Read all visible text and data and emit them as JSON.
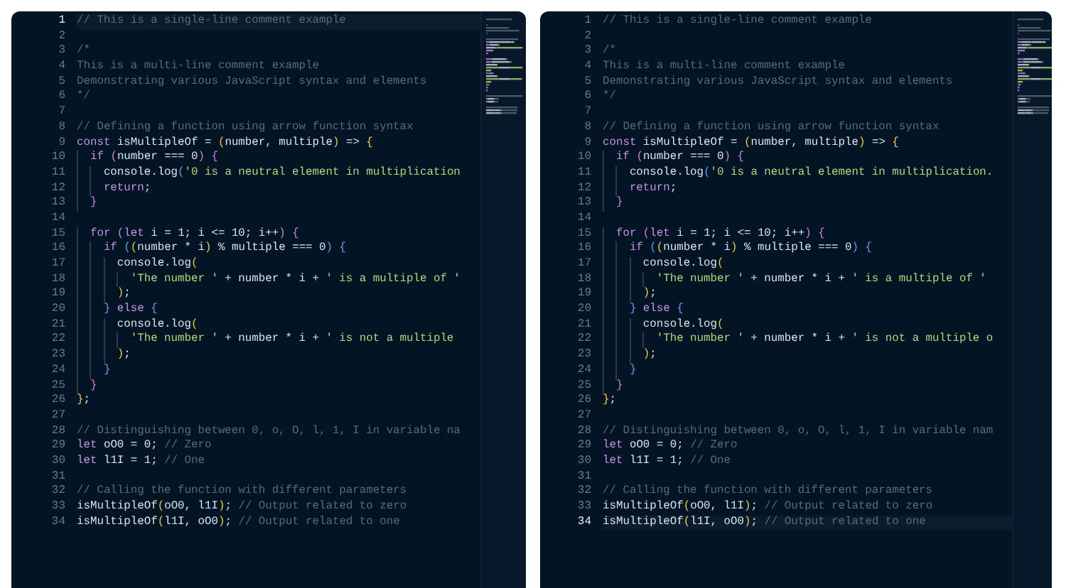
{
  "editors": [
    {
      "lines": [
        {
          "number": "1",
          "selected": true,
          "tokens": [
            {
              "kind": "comment",
              "text": "// This is a single-line comment example"
            }
          ]
        },
        {
          "number": "2",
          "selected": false
        },
        {
          "number": "3",
          "selected": false,
          "tokens": [
            {
              "kind": "comment",
              "text": "/*"
            }
          ]
        },
        {
          "number": "4",
          "selected": false,
          "tokens": [
            {
              "kind": "comment",
              "text": "This is a multi-line comment example"
            }
          ]
        },
        {
          "number": "5",
          "selected": false,
          "tokens": [
            {
              "kind": "comment",
              "text": "Demonstrating various JavaScript syntax and elements"
            }
          ]
        },
        {
          "number": "6",
          "selected": false,
          "tokens": [
            {
              "kind": "comment",
              "text": "*/"
            }
          ]
        },
        {
          "number": "7",
          "selected": false
        },
        {
          "number": "8",
          "selected": false,
          "tokens": [
            {
              "kind": "comment",
              "text": "// Defining a function using arrow function syntax"
            }
          ]
        },
        {
          "number": "9",
          "selected": false,
          "tokens": [
            {
              "kind": "keyword",
              "text": "const"
            },
            {
              "kind": "plain",
              "text": " isMultipleOf = "
            },
            {
              "kind": "bracket1",
              "text": "("
            },
            {
              "kind": "plain",
              "text": "number, multiple"
            },
            {
              "kind": "bracket1",
              "text": ")"
            },
            {
              "kind": "plain",
              "text": " => "
            },
            {
              "kind": "bracket1",
              "text": "{"
            }
          ]
        },
        {
          "number": "10",
          "selected": false,
          "tokens": [
            {
              "kind": "keyword",
              "text": "  if"
            },
            {
              "kind": "bracket2",
              "text": " ("
            },
            {
              "kind": "plain",
              "text": "number === 0"
            },
            {
              "kind": "bracket2",
              "text": ")"
            },
            {
              "kind": "bracket2",
              "text": " {"
            }
          ]
        },
        {
          "number": "11",
          "selected": false,
          "tokens": [
            {
              "kind": "plain",
              "text": "    console.log"
            },
            {
              "kind": "bracket3",
              "text": "("
            },
            {
              "kind": "string",
              "text": "'0 is a neutral element in multiplication"
            }
          ]
        },
        {
          "number": "12",
          "selected": false,
          "tokens": [
            {
              "kind": "keyword",
              "text": "    return"
            },
            {
              "kind": "plain",
              "text": ";"
            }
          ]
        },
        {
          "number": "13",
          "selected": false,
          "tokens": [
            {
              "kind": "bracket2",
              "text": "  }"
            }
          ]
        },
        {
          "number": "14",
          "selected": false
        },
        {
          "number": "15",
          "selected": false,
          "tokens": [
            {
              "kind": "keyword",
              "text": "  for"
            },
            {
              "kind": "bracket2",
              "text": " ("
            },
            {
              "kind": "keyword",
              "text": "let"
            },
            {
              "kind": "plain",
              "text": " i = 1; i <= 10; i++"
            },
            {
              "kind": "bracket2",
              "text": ")"
            },
            {
              "kind": "bracket2",
              "text": " {"
            }
          ]
        },
        {
          "number": "16",
          "selected": false,
          "tokens": [
            {
              "kind": "keyword",
              "text": "    if"
            },
            {
              "kind": "bracket3",
              "text": " ("
            },
            {
              "kind": "bracket1",
              "text": "("
            },
            {
              "kind": "plain",
              "text": "number * i"
            },
            {
              "kind": "bracket1",
              "text": ")"
            },
            {
              "kind": "plain",
              "text": " % multiple === 0"
            },
            {
              "kind": "bracket3",
              "text": ")"
            },
            {
              "kind": "bracket3",
              "text": " {"
            }
          ]
        },
        {
          "number": "17",
          "selected": false,
          "tokens": [
            {
              "kind": "plain",
              "text": "      console.log"
            },
            {
              "kind": "bracket1",
              "text": "("
            }
          ]
        },
        {
          "number": "18",
          "selected": false,
          "tokens": [
            {
              "kind": "string",
              "text": "        'The number '"
            },
            {
              "kind": "plain",
              "text": " + number * i + "
            },
            {
              "kind": "string",
              "text": "' is a multiple of '"
            }
          ]
        },
        {
          "number": "19",
          "selected": false,
          "tokens": [
            {
              "kind": "bracket1",
              "text": "      )"
            },
            {
              "kind": "plain",
              "text": ";"
            }
          ]
        },
        {
          "number": "20",
          "selected": false,
          "tokens": [
            {
              "kind": "bracket3",
              "text": "    }"
            },
            {
              "kind": "keyword",
              "text": " else"
            },
            {
              "kind": "bracket3",
              "text": " {"
            }
          ]
        },
        {
          "number": "21",
          "selected": false,
          "tokens": [
            {
              "kind": "plain",
              "text": "      console.log"
            },
            {
              "kind": "bracket1",
              "text": "("
            }
          ]
        },
        {
          "number": "22",
          "selected": false,
          "tokens": [
            {
              "kind": "string",
              "text": "        'The number '"
            },
            {
              "kind": "plain",
              "text": " + number * i + "
            },
            {
              "kind": "string",
              "text": "' is not a multiple"
            }
          ]
        },
        {
          "number": "23",
          "selected": false,
          "tokens": [
            {
              "kind": "bracket1",
              "text": "      )"
            },
            {
              "kind": "plain",
              "text": ";"
            }
          ]
        },
        {
          "number": "24",
          "selected": false,
          "tokens": [
            {
              "kind": "bracket3",
              "text": "    }"
            }
          ]
        },
        {
          "number": "25",
          "selected": false,
          "tokens": [
            {
              "kind": "bracket2",
              "text": "  }"
            }
          ]
        },
        {
          "number": "26",
          "selected": false,
          "tokens": [
            {
              "kind": "bracket1",
              "text": "}"
            },
            {
              "kind": "plain",
              "text": ";"
            }
          ]
        },
        {
          "number": "27",
          "selected": false
        },
        {
          "number": "28",
          "selected": false,
          "tokens": [
            {
              "kind": "comment",
              "text": "// Distinguishing between 0, o, O, l, 1, I in variable na"
            }
          ]
        },
        {
          "number": "29",
          "selected": false,
          "tokens": [
            {
              "kind": "keyword",
              "text": "let"
            },
            {
              "kind": "plain",
              "text": " oO0 = 0; "
            },
            {
              "kind": "comment",
              "text": "// Zero"
            }
          ]
        },
        {
          "number": "30",
          "selected": false,
          "tokens": [
            {
              "kind": "keyword",
              "text": "let"
            },
            {
              "kind": "plain",
              "text": " l1I = 1; "
            },
            {
              "kind": "comment",
              "text": "// One"
            }
          ]
        },
        {
          "number": "31",
          "selected": false
        },
        {
          "number": "32",
          "selected": false,
          "tokens": [
            {
              "kind": "comment",
              "text": "// Calling the function with different parameters"
            }
          ]
        },
        {
          "number": "33",
          "selected": false,
          "tokens": [
            {
              "kind": "plain",
              "text": "isMultipleOf"
            },
            {
              "kind": "bracket1",
              "text": "("
            },
            {
              "kind": "plain",
              "text": "oO0, l1I"
            },
            {
              "kind": "bracket1",
              "text": ")"
            },
            {
              "kind": "plain",
              "text": "; "
            },
            {
              "kind": "comment",
              "text": "// Output related to zero"
            }
          ]
        },
        {
          "number": "34",
          "selected": false,
          "tokens": [
            {
              "kind": "plain",
              "text": "isMultipleOf"
            },
            {
              "kind": "bracket1",
              "text": "("
            },
            {
              "kind": "plain",
              "text": "l1I, oO0"
            },
            {
              "kind": "bracket1",
              "text": ")"
            },
            {
              "kind": "plain",
              "text": "; "
            },
            {
              "kind": "comment",
              "text": "// Output related to one"
            }
          ]
        }
      ]
    },
    {
      "lines": [
        {
          "number": "1",
          "selected": false,
          "tokens": [
            {
              "kind": "comment",
              "text": "// This is a single-line comment example"
            }
          ]
        },
        {
          "number": "2",
          "selected": false
        },
        {
          "number": "3",
          "selected": false,
          "tokens": [
            {
              "kind": "comment",
              "text": "/*"
            }
          ]
        },
        {
          "number": "4",
          "selected": false,
          "tokens": [
            {
              "kind": "comment",
              "text": "This is a multi-line comment example"
            }
          ]
        },
        {
          "number": "5",
          "selected": false,
          "tokens": [
            {
              "kind": "comment",
              "text": "Demonstrating various JavaScript syntax and elements"
            }
          ]
        },
        {
          "number": "6",
          "selected": false,
          "tokens": [
            {
              "kind": "comment",
              "text": "*/"
            }
          ]
        },
        {
          "number": "7",
          "selected": false
        },
        {
          "number": "8",
          "selected": false,
          "tokens": [
            {
              "kind": "comment",
              "text": "// Defining a function using arrow function syntax"
            }
          ]
        },
        {
          "number": "9",
          "selected": false,
          "tokens": [
            {
              "kind": "keyword",
              "text": "const"
            },
            {
              "kind": "plain",
              "text": " isMultipleOf = "
            },
            {
              "kind": "bracket1",
              "text": "("
            },
            {
              "kind": "plain",
              "text": "number, multiple"
            },
            {
              "kind": "bracket1",
              "text": ")"
            },
            {
              "kind": "plain",
              "text": " => "
            },
            {
              "kind": "bracket1",
              "text": "{"
            }
          ]
        },
        {
          "number": "10",
          "selected": false,
          "tokens": [
            {
              "kind": "keyword",
              "text": "  if"
            },
            {
              "kind": "bracket2",
              "text": " ("
            },
            {
              "kind": "plain",
              "text": "number === 0"
            },
            {
              "kind": "bracket2",
              "text": ")"
            },
            {
              "kind": "bracket2",
              "text": " {"
            }
          ]
        },
        {
          "number": "11",
          "selected": false,
          "tokens": [
            {
              "kind": "plain",
              "text": "    console.log"
            },
            {
              "kind": "bracket3",
              "text": "("
            },
            {
              "kind": "string",
              "text": "'0 is a neutral element in multiplication."
            }
          ]
        },
        {
          "number": "12",
          "selected": false,
          "tokens": [
            {
              "kind": "keyword",
              "text": "    return"
            },
            {
              "kind": "plain",
              "text": ";"
            }
          ]
        },
        {
          "number": "13",
          "selected": false,
          "tokens": [
            {
              "kind": "bracket2",
              "text": "  }"
            }
          ]
        },
        {
          "number": "14",
          "selected": false
        },
        {
          "number": "15",
          "selected": false,
          "tokens": [
            {
              "kind": "keyword",
              "text": "  for"
            },
            {
              "kind": "bracket2",
              "text": " ("
            },
            {
              "kind": "keyword",
              "text": "let"
            },
            {
              "kind": "plain",
              "text": " i = 1; i <= 10; i++"
            },
            {
              "kind": "bracket2",
              "text": ")"
            },
            {
              "kind": "bracket2",
              "text": " {"
            }
          ]
        },
        {
          "number": "16",
          "selected": false,
          "tokens": [
            {
              "kind": "keyword",
              "text": "    if"
            },
            {
              "kind": "bracket3",
              "text": " ("
            },
            {
              "kind": "bracket1",
              "text": "("
            },
            {
              "kind": "plain",
              "text": "number * i"
            },
            {
              "kind": "bracket1",
              "text": ")"
            },
            {
              "kind": "plain",
              "text": " % multiple === 0"
            },
            {
              "kind": "bracket3",
              "text": ")"
            },
            {
              "kind": "bracket3",
              "text": " {"
            }
          ]
        },
        {
          "number": "17",
          "selected": false,
          "tokens": [
            {
              "kind": "plain",
              "text": "      console.log"
            },
            {
              "kind": "bracket1",
              "text": "("
            }
          ]
        },
        {
          "number": "18",
          "selected": false,
          "tokens": [
            {
              "kind": "string",
              "text": "        'The number '"
            },
            {
              "kind": "plain",
              "text": " + number * i + "
            },
            {
              "kind": "string",
              "text": "' is a multiple of '"
            }
          ]
        },
        {
          "number": "19",
          "selected": false,
          "tokens": [
            {
              "kind": "bracket1",
              "text": "      )"
            },
            {
              "kind": "plain",
              "text": ";"
            }
          ]
        },
        {
          "number": "20",
          "selected": false,
          "tokens": [
            {
              "kind": "bracket3",
              "text": "    }"
            },
            {
              "kind": "keyword",
              "text": " else"
            },
            {
              "kind": "bracket3",
              "text": " {"
            }
          ]
        },
        {
          "number": "21",
          "selected": false,
          "tokens": [
            {
              "kind": "plain",
              "text": "      console.log"
            },
            {
              "kind": "bracket1",
              "text": "("
            }
          ]
        },
        {
          "number": "22",
          "selected": false,
          "tokens": [
            {
              "kind": "string",
              "text": "        'The number '"
            },
            {
              "kind": "plain",
              "text": " + number * i + "
            },
            {
              "kind": "string",
              "text": "' is not a multiple o"
            }
          ]
        },
        {
          "number": "23",
          "selected": false,
          "tokens": [
            {
              "kind": "bracket1",
              "text": "      )"
            },
            {
              "kind": "plain",
              "text": ";"
            }
          ]
        },
        {
          "number": "24",
          "selected": false,
          "tokens": [
            {
              "kind": "bracket3",
              "text": "    }"
            }
          ]
        },
        {
          "number": "25",
          "selected": false,
          "tokens": [
            {
              "kind": "bracket2",
              "text": "  }"
            }
          ]
        },
        {
          "number": "26",
          "selected": false,
          "tokens": [
            {
              "kind": "bracket1",
              "text": "}"
            },
            {
              "kind": "plain",
              "text": ";"
            }
          ]
        },
        {
          "number": "27",
          "selected": false
        },
        {
          "number": "28",
          "selected": false,
          "tokens": [
            {
              "kind": "comment",
              "text": "// Distinguishing between 0, o, O, l, 1, I in variable nam"
            }
          ]
        },
        {
          "number": "29",
          "selected": false,
          "tokens": [
            {
              "kind": "keyword",
              "text": "let"
            },
            {
              "kind": "plain",
              "text": " oO0 = 0; "
            },
            {
              "kind": "comment",
              "text": "// Zero"
            }
          ]
        },
        {
          "number": "30",
          "selected": false,
          "tokens": [
            {
              "kind": "keyword",
              "text": "let"
            },
            {
              "kind": "plain",
              "text": " l1I = 1; "
            },
            {
              "kind": "comment",
              "text": "// One"
            }
          ]
        },
        {
          "number": "31",
          "selected": false
        },
        {
          "number": "32",
          "selected": false,
          "tokens": [
            {
              "kind": "comment",
              "text": "// Calling the function with different parameters"
            }
          ]
        },
        {
          "number": "33",
          "selected": false,
          "tokens": [
            {
              "kind": "plain",
              "text": "isMultipleOf"
            },
            {
              "kind": "bracket1",
              "text": "("
            },
            {
              "kind": "plain",
              "text": "oO0, l1I"
            },
            {
              "kind": "bracket1",
              "text": ")"
            },
            {
              "kind": "plain",
              "text": "; "
            },
            {
              "kind": "comment",
              "text": "// Output related to zero"
            }
          ]
        },
        {
          "number": "34",
          "selected": true,
          "tokens": [
            {
              "kind": "plain",
              "text": "isMultipleOf"
            },
            {
              "kind": "bracket1",
              "text": "("
            },
            {
              "kind": "plain",
              "text": "l1I, oO0"
            },
            {
              "kind": "bracket1",
              "text": ")"
            },
            {
              "kind": "plain",
              "text": "; "
            },
            {
              "kind": "comment",
              "text": "// Output related to one"
            }
          ]
        }
      ]
    }
  ]
}
